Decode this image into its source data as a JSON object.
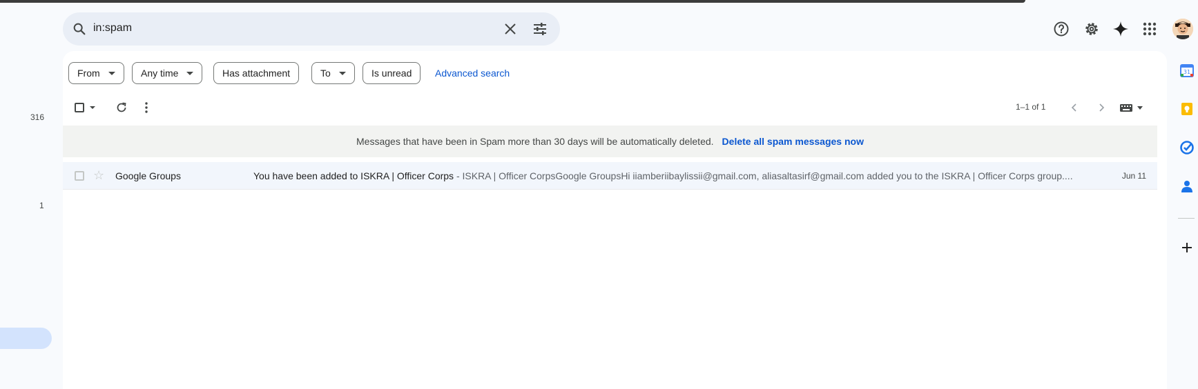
{
  "search": {
    "query": "in:spam"
  },
  "sidebar": {
    "counts": [
      "316",
      "1"
    ]
  },
  "filters": {
    "chips": [
      {
        "label": "From",
        "has_dropdown": true
      },
      {
        "label": "Any time",
        "has_dropdown": true
      },
      {
        "label": "Has attachment",
        "has_dropdown": false
      },
      {
        "label": "To",
        "has_dropdown": true
      },
      {
        "label": "Is unread",
        "has_dropdown": false
      }
    ],
    "advanced_label": "Advanced search"
  },
  "toolbar": {
    "pagination": "1–1 of 1"
  },
  "notice": {
    "message": "Messages that have been in Spam more than 30 days will be automatically deleted.",
    "action": "Delete all spam messages now"
  },
  "emails": [
    {
      "sender": "Google Groups",
      "subject": "You have been added to ISKRA | Officer Corps",
      "snippet": " - ISKRA | Officer CorpsGoogle GroupsHi iiamberiibaylissii@gmail.com, aliasaltasirf@gmail.com added you to the ISKRA | Officer Corps group....",
      "date": "Jun 11"
    }
  ],
  "icons": {
    "search": "search-icon",
    "clear": "close-icon",
    "tune": "tune-icon",
    "help": "help-icon",
    "settings": "gear-icon",
    "gemini": "sparkle-icon",
    "apps": "apps-grid-icon"
  },
  "colors": {
    "accent": "#0b57d0",
    "search_bg": "#e9eef6",
    "row_bg": "#f2f6fc"
  }
}
